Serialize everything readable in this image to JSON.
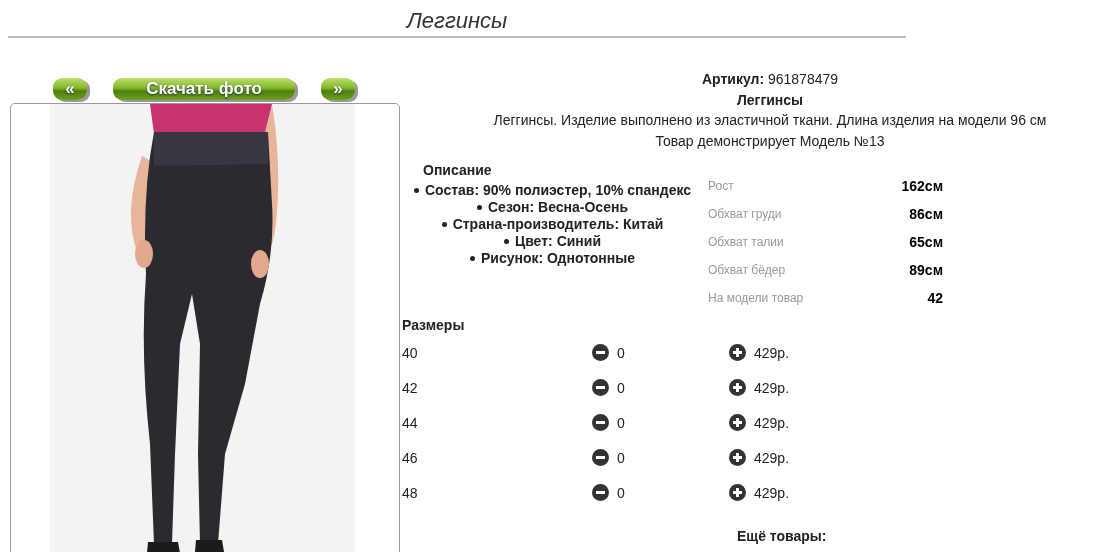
{
  "page_title": "Леггинсы",
  "gallery": {
    "prev_button": "«",
    "download_button": "Скачать фото",
    "next_button": "»"
  },
  "product": {
    "article": "**Артикул:** 961878479",
    "name": "Леггинсы",
    "summary": "Леггинсы. Изделие выполнено из эластичной ткани. Длина изделия на модели 96 см",
    "model_note": "Товар демонстрирует Модель №13"
  },
  "description": {
    "heading": "Описание",
    "items": [
      "Состав: 90% полиэстер, 10% спандекс",
      "Сезон: Весна-Осень",
      "Страна-производитель: Китай",
      "Цвет: Синий",
      "Рисунок: Однотонные"
    ]
  },
  "model_measurements": [
    {
      "label": "Рост",
      "value": "162см"
    },
    {
      "label": "Обхват груди",
      "value": "86см"
    },
    {
      "label": "Обхват талии",
      "value": "65см"
    },
    {
      "label": "Обхват бёдер",
      "value": "89см"
    },
    {
      "label": "На модели товар",
      "value": "42"
    }
  ],
  "sizes": {
    "heading": "Размеры",
    "rows": [
      {
        "size": "40",
        "count": "0",
        "price": "429р."
      },
      {
        "size": "42",
        "count": "0",
        "price": "429р."
      },
      {
        "size": "44",
        "count": "0",
        "price": "429р."
      },
      {
        "size": "46",
        "count": "0",
        "price": "429р."
      },
      {
        "size": "48",
        "count": "0",
        "price": "429р."
      }
    ]
  },
  "more_heading": "Ещё товары:"
}
